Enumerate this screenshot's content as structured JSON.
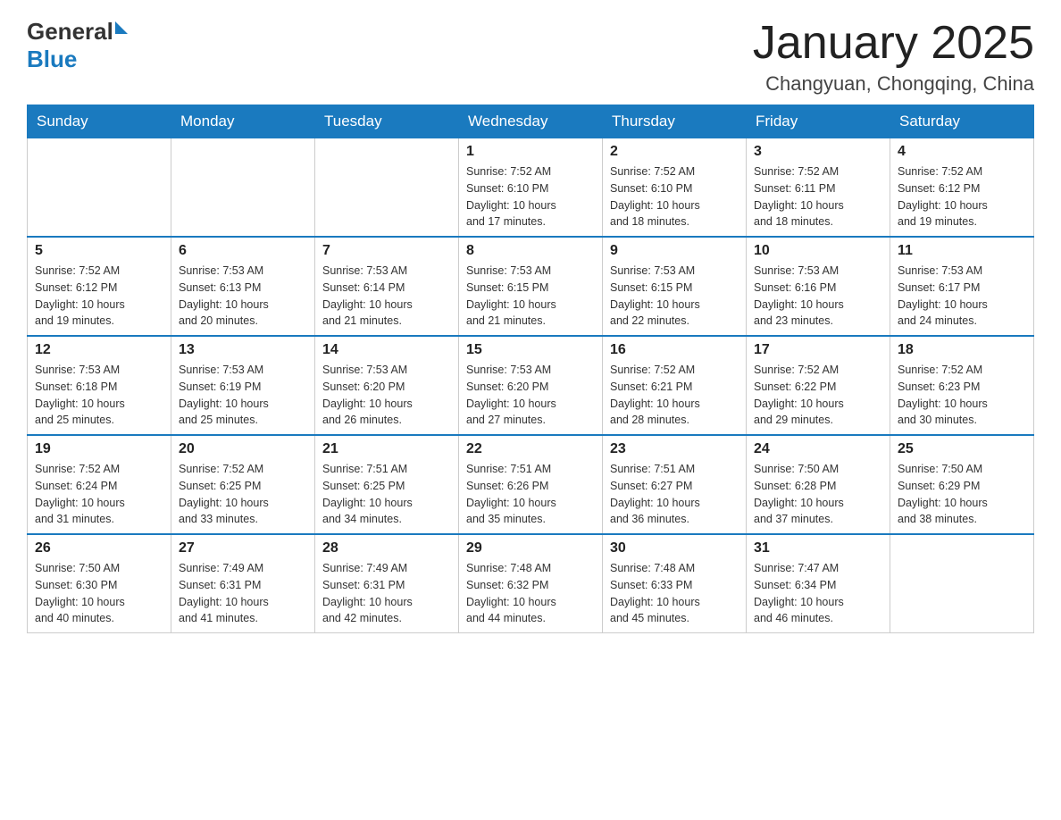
{
  "header": {
    "logo_general": "General",
    "logo_blue": "Blue",
    "month_title": "January 2025",
    "location": "Changyuan, Chongqing, China"
  },
  "days_of_week": [
    "Sunday",
    "Monday",
    "Tuesday",
    "Wednesday",
    "Thursday",
    "Friday",
    "Saturday"
  ],
  "weeks": [
    [
      {
        "day": "",
        "info": ""
      },
      {
        "day": "",
        "info": ""
      },
      {
        "day": "",
        "info": ""
      },
      {
        "day": "1",
        "info": "Sunrise: 7:52 AM\nSunset: 6:10 PM\nDaylight: 10 hours\nand 17 minutes."
      },
      {
        "day": "2",
        "info": "Sunrise: 7:52 AM\nSunset: 6:10 PM\nDaylight: 10 hours\nand 18 minutes."
      },
      {
        "day": "3",
        "info": "Sunrise: 7:52 AM\nSunset: 6:11 PM\nDaylight: 10 hours\nand 18 minutes."
      },
      {
        "day": "4",
        "info": "Sunrise: 7:52 AM\nSunset: 6:12 PM\nDaylight: 10 hours\nand 19 minutes."
      }
    ],
    [
      {
        "day": "5",
        "info": "Sunrise: 7:52 AM\nSunset: 6:12 PM\nDaylight: 10 hours\nand 19 minutes."
      },
      {
        "day": "6",
        "info": "Sunrise: 7:53 AM\nSunset: 6:13 PM\nDaylight: 10 hours\nand 20 minutes."
      },
      {
        "day": "7",
        "info": "Sunrise: 7:53 AM\nSunset: 6:14 PM\nDaylight: 10 hours\nand 21 minutes."
      },
      {
        "day": "8",
        "info": "Sunrise: 7:53 AM\nSunset: 6:15 PM\nDaylight: 10 hours\nand 21 minutes."
      },
      {
        "day": "9",
        "info": "Sunrise: 7:53 AM\nSunset: 6:15 PM\nDaylight: 10 hours\nand 22 minutes."
      },
      {
        "day": "10",
        "info": "Sunrise: 7:53 AM\nSunset: 6:16 PM\nDaylight: 10 hours\nand 23 minutes."
      },
      {
        "day": "11",
        "info": "Sunrise: 7:53 AM\nSunset: 6:17 PM\nDaylight: 10 hours\nand 24 minutes."
      }
    ],
    [
      {
        "day": "12",
        "info": "Sunrise: 7:53 AM\nSunset: 6:18 PM\nDaylight: 10 hours\nand 25 minutes."
      },
      {
        "day": "13",
        "info": "Sunrise: 7:53 AM\nSunset: 6:19 PM\nDaylight: 10 hours\nand 25 minutes."
      },
      {
        "day": "14",
        "info": "Sunrise: 7:53 AM\nSunset: 6:20 PM\nDaylight: 10 hours\nand 26 minutes."
      },
      {
        "day": "15",
        "info": "Sunrise: 7:53 AM\nSunset: 6:20 PM\nDaylight: 10 hours\nand 27 minutes."
      },
      {
        "day": "16",
        "info": "Sunrise: 7:52 AM\nSunset: 6:21 PM\nDaylight: 10 hours\nand 28 minutes."
      },
      {
        "day": "17",
        "info": "Sunrise: 7:52 AM\nSunset: 6:22 PM\nDaylight: 10 hours\nand 29 minutes."
      },
      {
        "day": "18",
        "info": "Sunrise: 7:52 AM\nSunset: 6:23 PM\nDaylight: 10 hours\nand 30 minutes."
      }
    ],
    [
      {
        "day": "19",
        "info": "Sunrise: 7:52 AM\nSunset: 6:24 PM\nDaylight: 10 hours\nand 31 minutes."
      },
      {
        "day": "20",
        "info": "Sunrise: 7:52 AM\nSunset: 6:25 PM\nDaylight: 10 hours\nand 33 minutes."
      },
      {
        "day": "21",
        "info": "Sunrise: 7:51 AM\nSunset: 6:25 PM\nDaylight: 10 hours\nand 34 minutes."
      },
      {
        "day": "22",
        "info": "Sunrise: 7:51 AM\nSunset: 6:26 PM\nDaylight: 10 hours\nand 35 minutes."
      },
      {
        "day": "23",
        "info": "Sunrise: 7:51 AM\nSunset: 6:27 PM\nDaylight: 10 hours\nand 36 minutes."
      },
      {
        "day": "24",
        "info": "Sunrise: 7:50 AM\nSunset: 6:28 PM\nDaylight: 10 hours\nand 37 minutes."
      },
      {
        "day": "25",
        "info": "Sunrise: 7:50 AM\nSunset: 6:29 PM\nDaylight: 10 hours\nand 38 minutes."
      }
    ],
    [
      {
        "day": "26",
        "info": "Sunrise: 7:50 AM\nSunset: 6:30 PM\nDaylight: 10 hours\nand 40 minutes."
      },
      {
        "day": "27",
        "info": "Sunrise: 7:49 AM\nSunset: 6:31 PM\nDaylight: 10 hours\nand 41 minutes."
      },
      {
        "day": "28",
        "info": "Sunrise: 7:49 AM\nSunset: 6:31 PM\nDaylight: 10 hours\nand 42 minutes."
      },
      {
        "day": "29",
        "info": "Sunrise: 7:48 AM\nSunset: 6:32 PM\nDaylight: 10 hours\nand 44 minutes."
      },
      {
        "day": "30",
        "info": "Sunrise: 7:48 AM\nSunset: 6:33 PM\nDaylight: 10 hours\nand 45 minutes."
      },
      {
        "day": "31",
        "info": "Sunrise: 7:47 AM\nSunset: 6:34 PM\nDaylight: 10 hours\nand 46 minutes."
      },
      {
        "day": "",
        "info": ""
      }
    ]
  ]
}
